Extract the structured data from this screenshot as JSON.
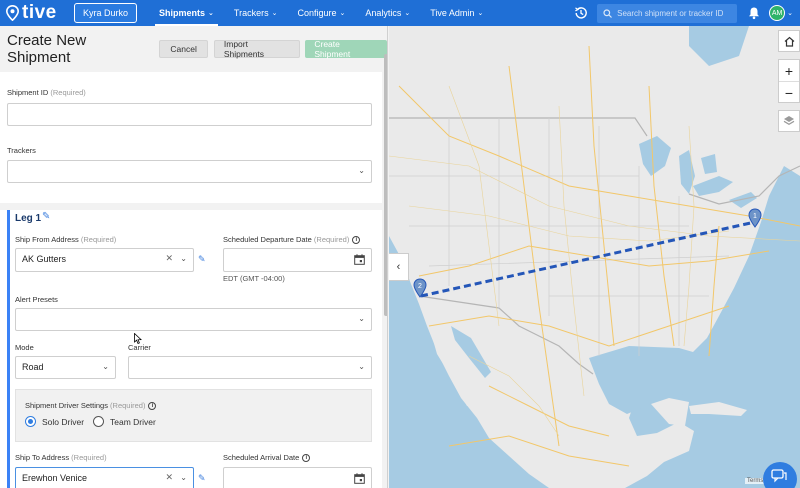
{
  "topbar": {
    "logo_text": "tive",
    "org_name": "Kyra Durko",
    "nav": [
      {
        "label": "Shipments",
        "active": true
      },
      {
        "label": "Trackers",
        "active": false
      },
      {
        "label": "Configure",
        "active": false
      },
      {
        "label": "Analytics",
        "active": false
      },
      {
        "label": "Tive Admin",
        "active": false
      }
    ],
    "search_placeholder": "Search shipment or tracker ID",
    "avatar_initials": "AM",
    "accent_color": "#1f6fd6"
  },
  "header": {
    "title": "Create New Shipment",
    "cancel_label": "Cancel",
    "import_label": "Import Shipments",
    "create_label": "Create Shipment"
  },
  "form": {
    "shipment_id": {
      "label": "Shipment ID",
      "required": "(Required)",
      "value": ""
    },
    "trackers": {
      "label": "Trackers",
      "value": ""
    },
    "leg": {
      "title": "Leg 1",
      "ship_from": {
        "label": "Ship From Address",
        "required": "(Required)",
        "value": "AK Gutters"
      },
      "departure": {
        "label": "Scheduled Departure Date",
        "required": "(Required)",
        "value": "",
        "timezone": "EDT (GMT -04:00)"
      },
      "alert_presets": {
        "label": "Alert Presets",
        "value": ""
      },
      "mode": {
        "label": "Mode",
        "value": "Road"
      },
      "carrier": {
        "label": "Carrier",
        "value": ""
      },
      "driver_settings": {
        "label": "Shipment Driver Settings",
        "required": "(Required)",
        "options": [
          {
            "label": "Solo Driver",
            "selected": true
          },
          {
            "label": "Team Driver",
            "selected": false
          }
        ]
      },
      "ship_to": {
        "label": "Ship To Address",
        "required": "(Required)",
        "value": "Erewhon Venice"
      },
      "arrival": {
        "label": "Scheduled Arrival Date",
        "value": ""
      }
    }
  },
  "map": {
    "origin_marker": "1",
    "destination_marker": "2",
    "route_color": "#2456b8",
    "attribution": "Terms"
  }
}
